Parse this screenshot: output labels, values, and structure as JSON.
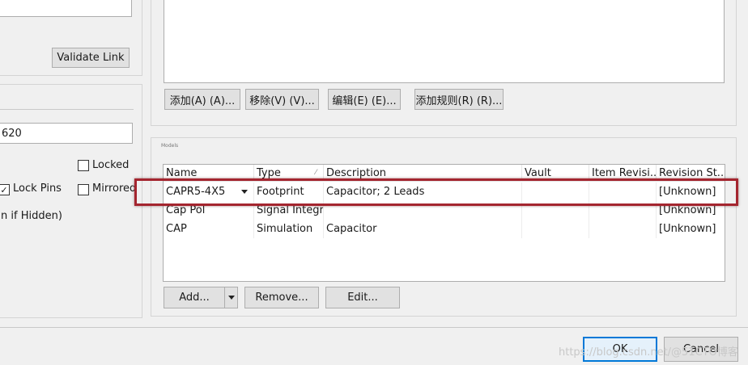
{
  "left": {
    "validate_link": "Validate Link",
    "value_field": "620",
    "locked_label": "Locked",
    "lock_pins_label": "Lock Pins",
    "mirrored_label": "Mirrored",
    "hidden_text": "n if Hidden)",
    "lock_pins_checked": true,
    "locked_checked": false,
    "mirrored_checked": false
  },
  "rules_buttons": {
    "add": "添加(A) (A)...",
    "remove": "移除(V) (V)...",
    "edit": "编辑(E) (E)...",
    "add_rule": "添加规则(R) (R)..."
  },
  "models": {
    "group_label": "Models",
    "columns": [
      "Name",
      "Type",
      "Description",
      "Vault",
      "Item Revisi...",
      "Revision St..."
    ],
    "rows": [
      {
        "name": "CAPR5-4X5",
        "type": "Footprint",
        "description": "Capacitor; 2 Leads",
        "vault": "",
        "item_revision": "",
        "revision_status": "[Unknown]"
      },
      {
        "name": "Cap Pol",
        "type": "Signal Integrit",
        "description": "",
        "vault": "",
        "item_revision": "",
        "revision_status": "[Unknown]"
      },
      {
        "name": "CAP",
        "type": "Simulation",
        "description": "Capacitor",
        "vault": "",
        "item_revision": "",
        "revision_status": "[Unknown]"
      }
    ],
    "add": "Add...",
    "remove": "Remove...",
    "edit": "Edit..."
  },
  "footer": {
    "ok": "OK",
    "cancel": "Cancel",
    "watermark": "https://blog.csdn.net/@51CTO博客"
  },
  "colors": {
    "highlight": "#a4252f",
    "accent": "#0078d7"
  }
}
